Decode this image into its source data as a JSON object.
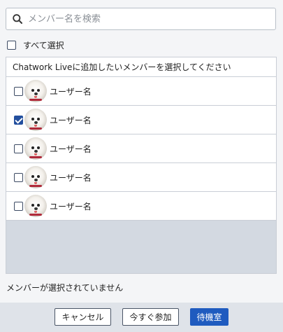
{
  "search": {
    "placeholder": "メンバー名を検索",
    "value": ""
  },
  "select_all": {
    "label": "すべて選択",
    "checked": false
  },
  "panel": {
    "header": "Chatwork Liveに追加したいメンバーを選択してください",
    "members": [
      {
        "name": "ユーザー名",
        "checked": false
      },
      {
        "name": "ユーザー名",
        "checked": true
      },
      {
        "name": "ユーザー名",
        "checked": false
      },
      {
        "name": "ユーザー名",
        "checked": false
      },
      {
        "name": "ユーザー名",
        "checked": false
      }
    ]
  },
  "status_text": "メンバーが選択されていません",
  "footer": {
    "cancel_label": "キャンセル",
    "join_label": "今すぐ参加",
    "waiting_room_label": "待機室"
  },
  "colors": {
    "primary": "#1f5bbf",
    "checkbox_checked": "#234f9e",
    "panel_empty": "#d3d9e1",
    "footer": "#dfe3e9"
  }
}
